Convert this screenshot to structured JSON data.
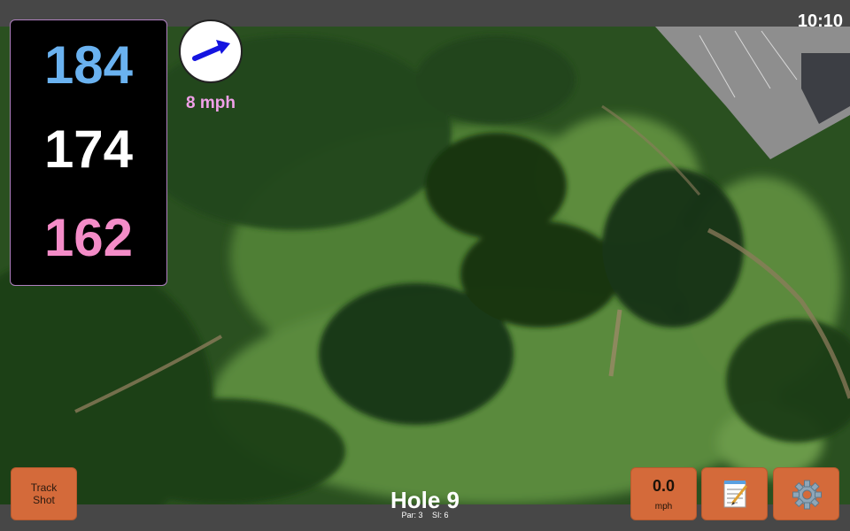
{
  "status": {
    "time": "10:10"
  },
  "yardages": {
    "back": "184",
    "middle": "174",
    "front": "162"
  },
  "wind": {
    "speed_label": "8 mph"
  },
  "hole": {
    "title": "Hole 9",
    "par": "Par: 3",
    "si": "SI: 6"
  },
  "buttons": {
    "track_shot": "Track Shot",
    "speed_value": "0.0",
    "speed_unit": "mph"
  },
  "colors": {
    "back": "#6ab2f0",
    "middle": "#ffffff",
    "front": "#f48cc8",
    "button": "#d46a3a",
    "wind_label": "#f0a0e8"
  },
  "icons": {
    "wind": "arrow-icon",
    "notes": "notepad-icon",
    "settings": "gear-icon"
  }
}
